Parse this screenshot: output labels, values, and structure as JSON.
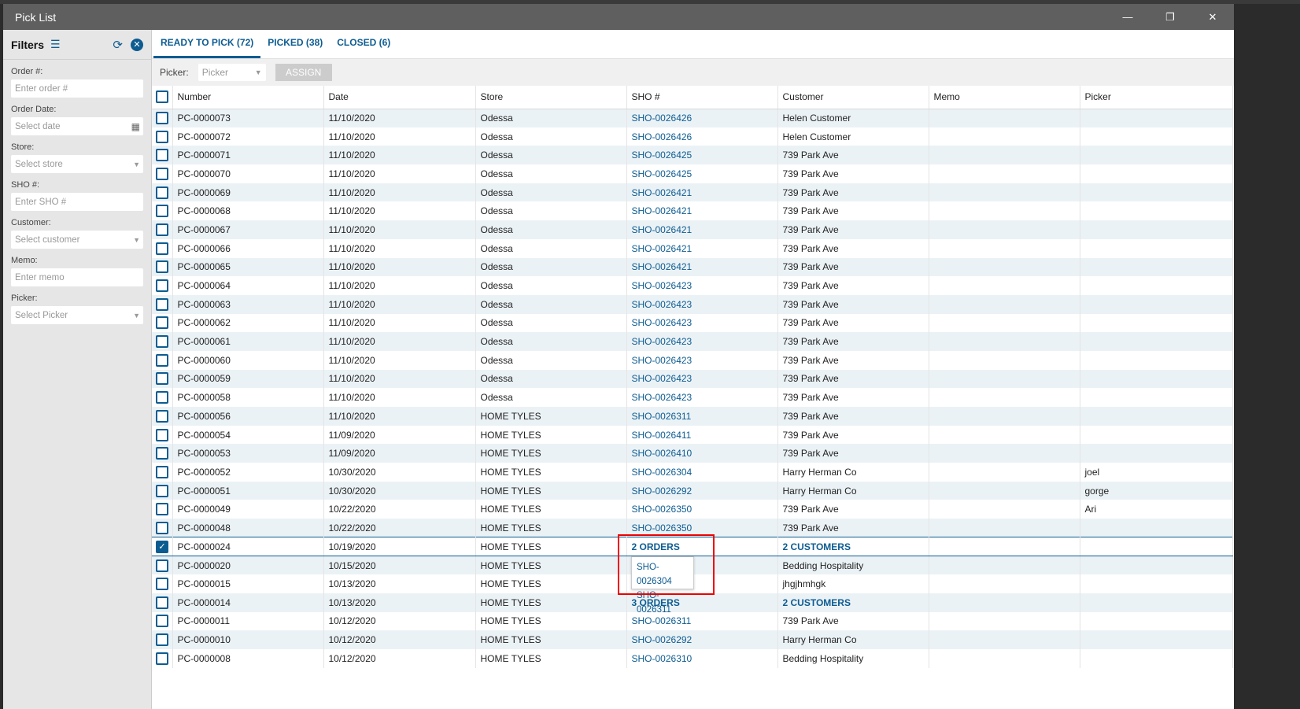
{
  "window": {
    "title": "Pick List",
    "minimize": "—",
    "restore": "❐",
    "close": "✕"
  },
  "filters": {
    "title": "Filters",
    "fields": [
      {
        "label": "Order #:",
        "placeholder": "Enter order #",
        "type": "text"
      },
      {
        "label": "Order Date:",
        "placeholder": "Select date",
        "type": "date"
      },
      {
        "label": "Store:",
        "placeholder": "Select store",
        "type": "select"
      },
      {
        "label": "SHO #:",
        "placeholder": "Enter SHO #",
        "type": "text"
      },
      {
        "label": "Customer:",
        "placeholder": "Select customer",
        "type": "select"
      },
      {
        "label": "Memo:",
        "placeholder": "Enter memo",
        "type": "text"
      },
      {
        "label": "Picker:",
        "placeholder": "Select Picker",
        "type": "select"
      }
    ]
  },
  "tabs": [
    {
      "label": "READY TO PICK (72)",
      "active": true
    },
    {
      "label": "PICKED (38)"
    },
    {
      "label": "CLOSED (6)"
    }
  ],
  "toolbar": {
    "picker_label": "Picker:",
    "picker_placeholder": "Picker",
    "assign": "ASSIGN"
  },
  "columns": [
    "Number",
    "Date",
    "Store",
    "SHO #",
    "Customer",
    "Memo",
    "Picker"
  ],
  "rows": [
    [
      "PC-0000073",
      "11/10/2020",
      "Odessa",
      "SHO-0026426",
      "Helen Customer",
      "",
      ""
    ],
    [
      "PC-0000072",
      "11/10/2020",
      "Odessa",
      "SHO-0026426",
      "Helen Customer",
      "",
      ""
    ],
    [
      "PC-0000071",
      "11/10/2020",
      "Odessa",
      "SHO-0026425",
      "739 Park Ave",
      "",
      ""
    ],
    [
      "PC-0000070",
      "11/10/2020",
      "Odessa",
      "SHO-0026425",
      "739 Park Ave",
      "",
      ""
    ],
    [
      "PC-0000069",
      "11/10/2020",
      "Odessa",
      "SHO-0026421",
      "739 Park Ave",
      "",
      ""
    ],
    [
      "PC-0000068",
      "11/10/2020",
      "Odessa",
      "SHO-0026421",
      "739 Park Ave",
      "",
      ""
    ],
    [
      "PC-0000067",
      "11/10/2020",
      "Odessa",
      "SHO-0026421",
      "739 Park Ave",
      "",
      ""
    ],
    [
      "PC-0000066",
      "11/10/2020",
      "Odessa",
      "SHO-0026421",
      "739 Park Ave",
      "",
      ""
    ],
    [
      "PC-0000065",
      "11/10/2020",
      "Odessa",
      "SHO-0026421",
      "739 Park Ave",
      "",
      ""
    ],
    [
      "PC-0000064",
      "11/10/2020",
      "Odessa",
      "SHO-0026423",
      "739 Park Ave",
      "",
      ""
    ],
    [
      "PC-0000063",
      "11/10/2020",
      "Odessa",
      "SHO-0026423",
      "739 Park Ave",
      "",
      ""
    ],
    [
      "PC-0000062",
      "11/10/2020",
      "Odessa",
      "SHO-0026423",
      "739 Park Ave",
      "",
      ""
    ],
    [
      "PC-0000061",
      "11/10/2020",
      "Odessa",
      "SHO-0026423",
      "739 Park Ave",
      "",
      ""
    ],
    [
      "PC-0000060",
      "11/10/2020",
      "Odessa",
      "SHO-0026423",
      "739 Park Ave",
      "",
      ""
    ],
    [
      "PC-0000059",
      "11/10/2020",
      "Odessa",
      "SHO-0026423",
      "739 Park Ave",
      "",
      ""
    ],
    [
      "PC-0000058",
      "11/10/2020",
      "Odessa",
      "SHO-0026423",
      "739 Park Ave",
      "",
      ""
    ],
    [
      "PC-0000056",
      "11/10/2020",
      "HOME TYLES",
      "SHO-0026311",
      "739 Park Ave",
      "",
      ""
    ],
    [
      "PC-0000054",
      "11/09/2020",
      "HOME TYLES",
      "SHO-0026411",
      "739 Park Ave",
      "",
      ""
    ],
    [
      "PC-0000053",
      "11/09/2020",
      "HOME TYLES",
      "SHO-0026410",
      "739 Park Ave",
      "",
      ""
    ],
    [
      "PC-0000052",
      "10/30/2020",
      "HOME TYLES",
      "SHO-0026304",
      "Harry Herman Co",
      "",
      "joel"
    ],
    [
      "PC-0000051",
      "10/30/2020",
      "HOME TYLES",
      "SHO-0026292",
      "Harry Herman Co",
      "",
      "gorge"
    ],
    [
      "PC-0000049",
      "10/22/2020",
      "HOME TYLES",
      "SHO-0026350",
      "739 Park Ave",
      "",
      "Ari"
    ],
    [
      "PC-0000048",
      "10/22/2020",
      "HOME TYLES",
      "SHO-0026350",
      "739 Park Ave",
      "",
      ""
    ],
    [
      "PC-0000024",
      "10/19/2020",
      "HOME TYLES",
      "2 ORDERS",
      "2 CUSTOMERS",
      "",
      ""
    ],
    [
      "PC-0000020",
      "10/15/2020",
      "HOME TYLES",
      "",
      "Bedding Hospitality",
      "",
      ""
    ],
    [
      "PC-0000015",
      "10/13/2020",
      "HOME TYLES",
      "",
      "jhgjhmhgk",
      "",
      ""
    ],
    [
      "PC-0000014",
      "10/13/2020",
      "HOME TYLES",
      "3 ORDERS",
      "2 CUSTOMERS",
      "",
      ""
    ],
    [
      "PC-0000011",
      "10/12/2020",
      "HOME TYLES",
      "SHO-0026311",
      "739 Park Ave",
      "",
      ""
    ],
    [
      "PC-0000010",
      "10/12/2020",
      "HOME TYLES",
      "SHO-0026292",
      "Harry Herman Co",
      "",
      ""
    ],
    [
      "PC-0000008",
      "10/12/2020",
      "HOME TYLES",
      "SHO-0026310",
      "Bedding Hospitality",
      "",
      ""
    ]
  ],
  "selected_row": 23,
  "popup": {
    "orders": [
      "SHO-0026304",
      "SHO-0026311"
    ]
  }
}
